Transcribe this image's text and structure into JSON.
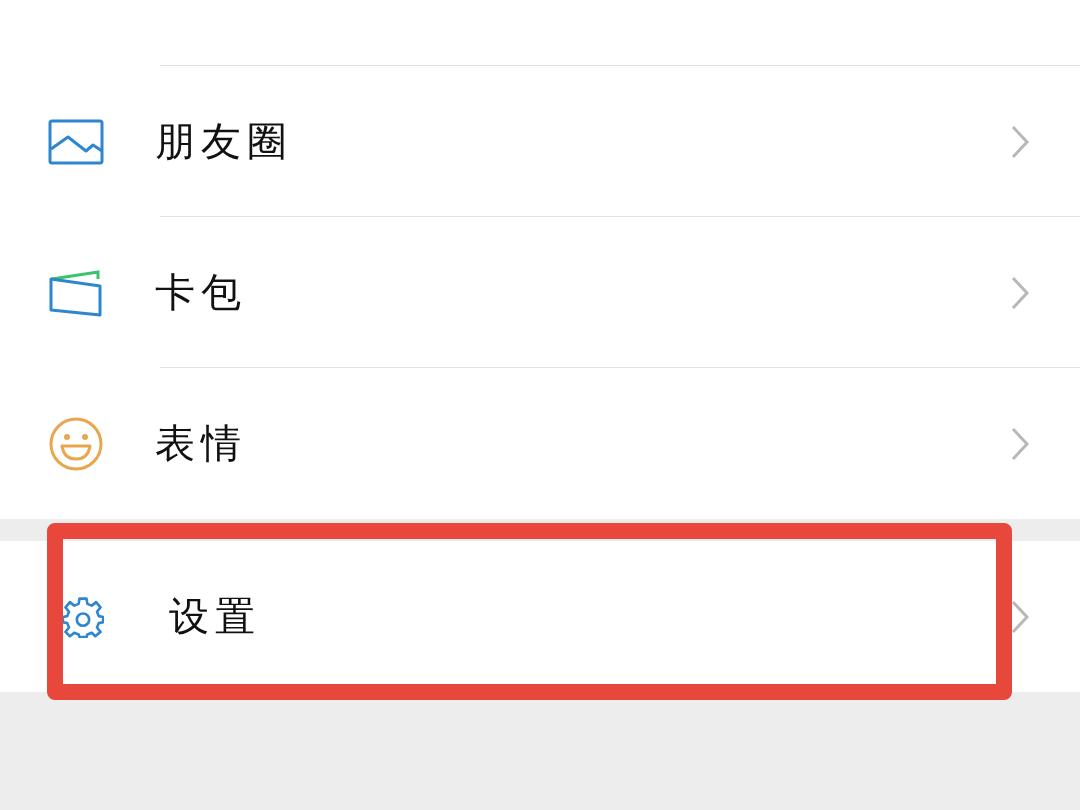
{
  "groups": [
    {
      "items": [
        {
          "label": "朋友圈",
          "kind": "photo",
          "highlighted": false
        },
        {
          "label": "卡包",
          "kind": "wallet",
          "highlighted": false
        },
        {
          "label": "表情",
          "kind": "smile",
          "highlighted": false
        }
      ]
    },
    {
      "items": [
        {
          "label": "设置",
          "kind": "gear",
          "highlighted": true
        }
      ]
    }
  ]
}
